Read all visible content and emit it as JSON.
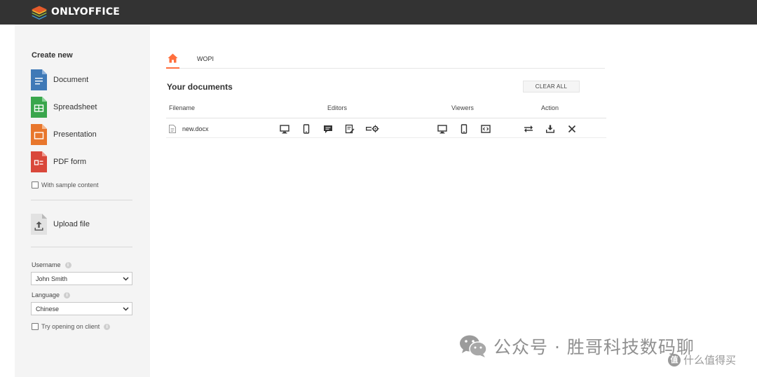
{
  "header": {
    "brand": "ONLYOFFICE",
    "colors": {
      "bar": "#333333",
      "accent": "#ff6f3d"
    }
  },
  "sidebar": {
    "create_title": "Create new",
    "create_items": [
      {
        "label": "Document",
        "icon": "document-icon",
        "color": "#3f79b7"
      },
      {
        "label": "Spreadsheet",
        "icon": "spreadsheet-icon",
        "color": "#3aa64c"
      },
      {
        "label": "Presentation",
        "icon": "presentation-icon",
        "color": "#e8762c"
      },
      {
        "label": "PDF form",
        "icon": "pdf-form-icon",
        "color": "#d9483b"
      }
    ],
    "sample_content_label": "With sample content",
    "upload_label": "Upload file",
    "username_label": "Username",
    "username_value": "John Smith",
    "language_label": "Language",
    "language_value": "Chinese",
    "try_client_label": "Try opening on client"
  },
  "tabs": {
    "home_icon": "home-icon",
    "wopi_label": "WOPI"
  },
  "documents": {
    "title": "Your documents",
    "clear_all": "CLEAR ALL",
    "columns": {
      "filename": "Filename",
      "editors": "Editors",
      "viewers": "Viewers",
      "action": "Action"
    },
    "rows": [
      {
        "filename": "new.docx"
      }
    ]
  },
  "watermark": {
    "text": "公众号 · 胜哥科技数码聊",
    "corner": "什么值得买",
    "corner_badge": "值"
  }
}
